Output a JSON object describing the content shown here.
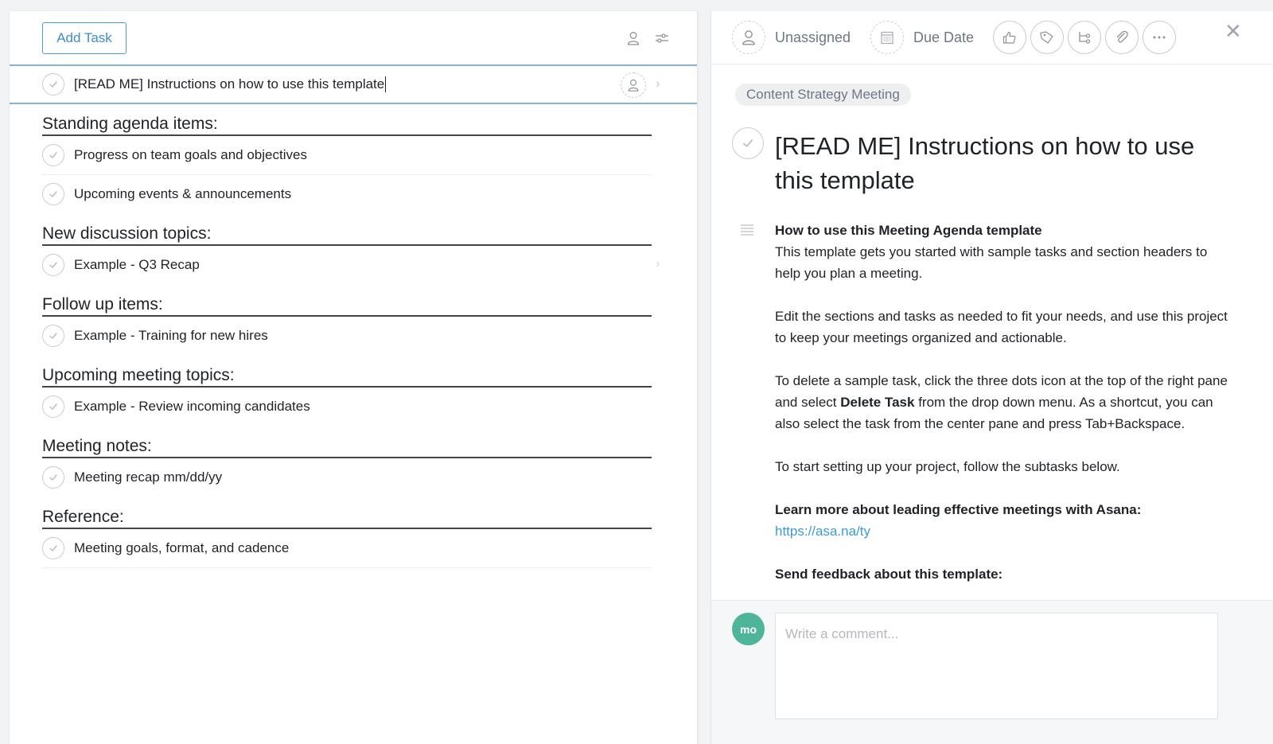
{
  "left_pane": {
    "toolbar": {
      "add_task_label": "Add Task",
      "icons": [
        "person-icon",
        "filter-sliders-icon"
      ]
    },
    "selected_task": {
      "title": "[READ ME] Instructions on how to use this template"
    },
    "sections": [
      {
        "header": "Standing agenda items:",
        "tasks": [
          "Progress on team goals and objectives",
          "Upcoming events & announcements"
        ]
      },
      {
        "header": "New discussion topics:",
        "tasks": [
          "Example - Q3 Recap"
        ]
      },
      {
        "header": "Follow up items:",
        "tasks": [
          "Example - Training for new hires"
        ]
      },
      {
        "header": "Upcoming meeting topics:",
        "tasks": [
          "Example - Review incoming candidates"
        ]
      },
      {
        "header": "Meeting notes:",
        "tasks": [
          "Meeting recap mm/dd/yy"
        ]
      },
      {
        "header": "Reference:",
        "tasks": [
          "Meeting goals, format, and cadence"
        ]
      }
    ]
  },
  "right_pane": {
    "toolbar": {
      "assignee_label": "Unassigned",
      "due_date_label": "Due Date",
      "action_icons": [
        "thumbs-up-icon",
        "tag-icon",
        "subtask-icon",
        "attachment-icon",
        "more-icon"
      ],
      "close_icon": "close-icon"
    },
    "project_tag": "Content Strategy Meeting",
    "task_title": "[READ ME] Instructions on how to use this template",
    "description": {
      "heading": "How to use this Meeting Agenda template",
      "p1": "This template gets you started with sample tasks and section headers to help you plan a meeting.",
      "p2": "Edit the sections and tasks as needed to fit your needs, and use this project to keep your meetings organized and actionable.",
      "p3_before": "To delete a sample task, click the three dots icon at the top of the right pane and select ",
      "p3_bold": "Delete Task",
      "p3_after": " from the drop down menu. As a shortcut, you can also select the task from the center pane and press Tab+Backspace.",
      "p4": "To start setting up your project, follow the subtasks below.",
      "learn_more_heading": "Learn more about leading effective meetings with Asana:",
      "learn_more_link": "https://asa.na/ty",
      "feedback_heading": "Send feedback about this template:"
    },
    "comment": {
      "avatar_initials": "mo",
      "placeholder": "Write a comment..."
    }
  },
  "colors": {
    "accent_blue": "#3d8ecb",
    "link_blue": "#3d9bd8",
    "avatar_green": "#4fb59a"
  }
}
